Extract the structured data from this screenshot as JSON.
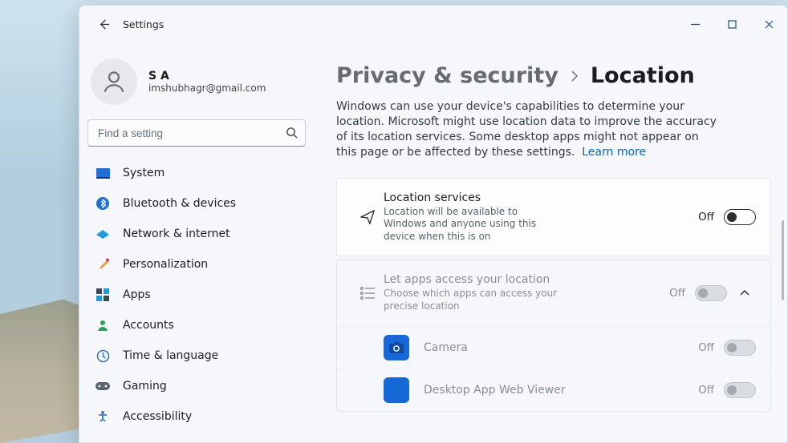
{
  "app": {
    "title": "Settings"
  },
  "profile": {
    "name": "S A",
    "email": "imshubhagr@gmail.com"
  },
  "search": {
    "placeholder": "Find a setting"
  },
  "sidebar": {
    "items": [
      {
        "label": "System"
      },
      {
        "label": "Bluetooth & devices"
      },
      {
        "label": "Network & internet"
      },
      {
        "label": "Personalization"
      },
      {
        "label": "Apps"
      },
      {
        "label": "Accounts"
      },
      {
        "label": "Time & language"
      },
      {
        "label": "Gaming"
      },
      {
        "label": "Accessibility"
      }
    ]
  },
  "breadcrumb": {
    "parent": "Privacy & security",
    "current": "Location"
  },
  "desc": "Windows can use your device's capabilities to determine your location. Microsoft might use location data to improve the accuracy of its location services. Some desktop apps might not appear on this page or be affected by these settings.",
  "learn_more": "Learn more",
  "location_services": {
    "title": "Location services",
    "sub": "Location will be available to Windows and anyone using this device when this is on",
    "state": "Off"
  },
  "apps_access": {
    "title": "Let apps access your location",
    "sub": "Choose which apps can access your precise location",
    "state": "Off",
    "items": [
      {
        "name": "Camera",
        "state": "Off"
      },
      {
        "name": "Desktop App Web Viewer",
        "state": "Off"
      }
    ]
  }
}
